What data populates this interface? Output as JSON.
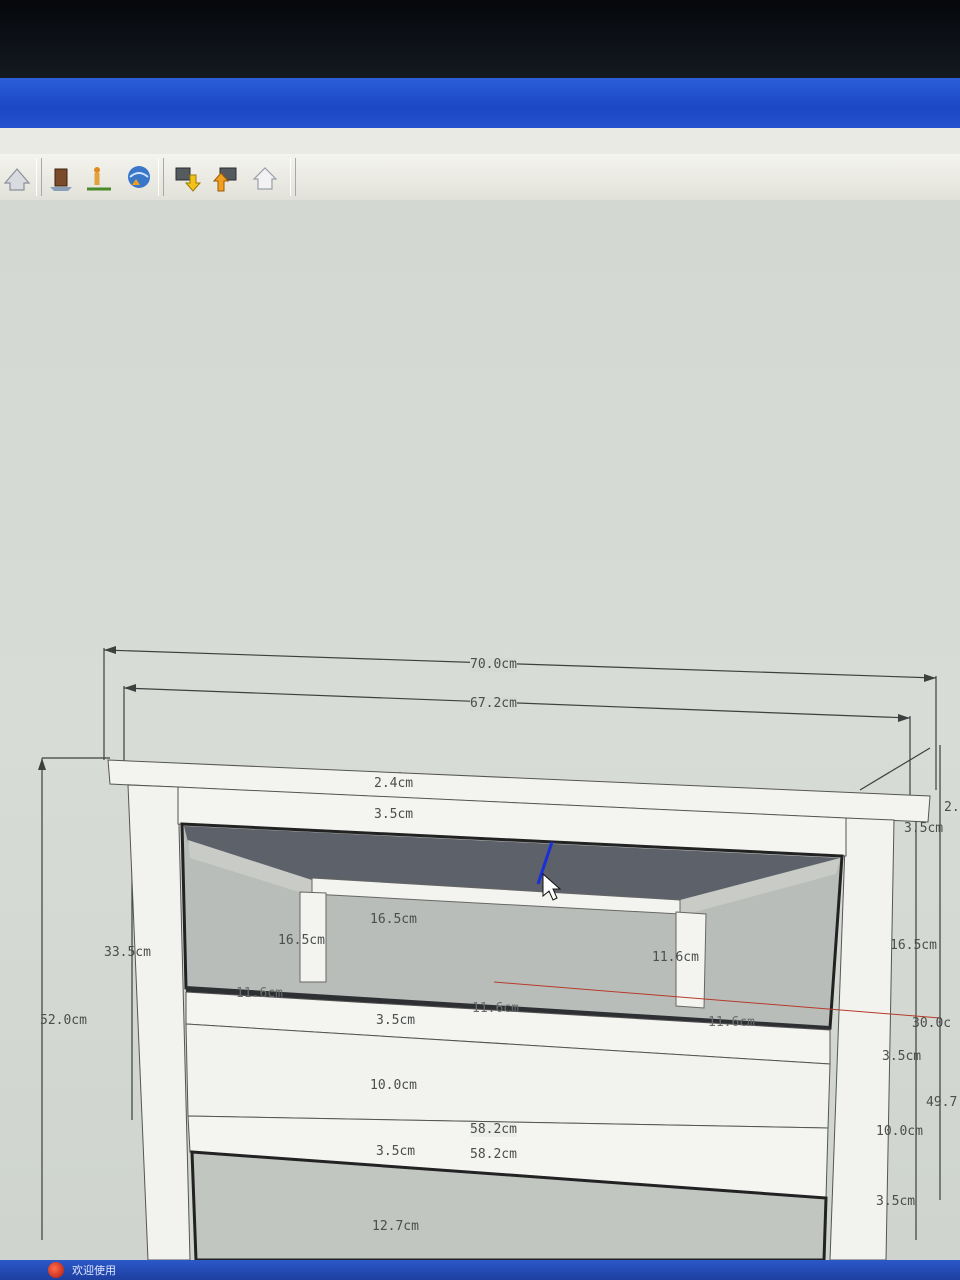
{
  "toolbar": {
    "icons": [
      "house-view-icon",
      "building-model-icon",
      "person-locate-icon",
      "globe-upload-icon",
      "component-download-icon",
      "component-upload-icon",
      "warehouse-share-icon"
    ]
  },
  "dimensions": {
    "overall_width": "70.0cm",
    "inner_width": "67.2cm",
    "top_thickness": "2.4cm",
    "apron_height": "3.5cm",
    "opening_height": "16.5cm",
    "opening_height_inner": "16.5cm",
    "side_height": "33.5cm",
    "total_height": "52.0cm",
    "inner_depth": "11.6cm",
    "rail_height": "3.5cm",
    "drawer_height": "10.0cm",
    "shelf_width_upper": "58.2cm",
    "shelf_width_lower": "58.2cm",
    "lower_rail": "3.5cm",
    "lower_opening": "12.7cm",
    "right_apron": "3.5cm",
    "right_opening": "16.5cm",
    "right_rail": "3.5cm",
    "right_side": "49.7",
    "right_drawer": "10.0cm",
    "right_lower_rail": "3.5cm",
    "right_depth": "30.0c",
    "bottom_left_dims": "11.6cm",
    "bottom_mid_dims": "11.6cm",
    "bottom_right_dims": "11.6cm",
    "right_top_small": "2."
  },
  "taskbar": {
    "item_label": "欢迎使用"
  },
  "colors": {
    "titlebar": "#1c47c4",
    "viewport": "#d6dbd5",
    "wood_face": "#f2f2ef",
    "inner_shade": "#5c6068"
  }
}
